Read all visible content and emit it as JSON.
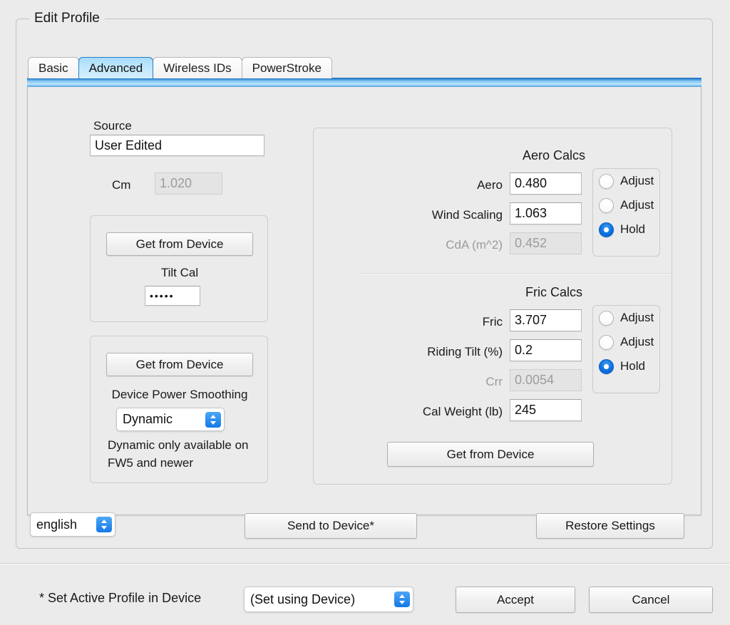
{
  "window": {
    "groupbox_title": "Edit Profile"
  },
  "tabs": [
    {
      "label": "Basic",
      "active": false
    },
    {
      "label": "Advanced",
      "active": true
    },
    {
      "label": "Wireless IDs",
      "active": false
    },
    {
      "label": "PowerStroke",
      "active": false
    }
  ],
  "left_panel": {
    "source_label": "Source",
    "source_value": "User Edited",
    "cm_label": "Cm",
    "cm_value": "1.020",
    "tilt_group": {
      "get_from_device_label": "Get from Device",
      "tilt_cal_label": "Tilt Cal",
      "tilt_cal_value": "•••••"
    },
    "smoothing_group": {
      "get_from_device_label": "Get from Device",
      "smoothing_label": "Device Power Smoothing",
      "smoothing_value": "Dynamic",
      "note_line1": "Dynamic only available on",
      "note_line2": "FW5 and newer"
    }
  },
  "right_panel": {
    "aero": {
      "title": "Aero Calcs",
      "rows": [
        {
          "label": "Aero",
          "value": "0.480",
          "disabled": false
        },
        {
          "label": "Wind Scaling",
          "value": "1.063",
          "disabled": false
        },
        {
          "label": "CdA (m^2)",
          "value": "0.452",
          "disabled": true
        }
      ],
      "options": [
        {
          "label": "Adjust",
          "selected": false
        },
        {
          "label": "Adjust",
          "selected": false
        },
        {
          "label": "Hold",
          "selected": true
        }
      ]
    },
    "fric": {
      "title": "Fric Calcs",
      "rows": [
        {
          "label": "Fric",
          "value": "3.707",
          "disabled": false
        },
        {
          "label": "Riding Tilt (%)",
          "value": "0.2",
          "disabled": false
        },
        {
          "label": "Crr",
          "value": "0.0054",
          "disabled": true
        },
        {
          "label": "Cal Weight (lb)",
          "value": "245",
          "disabled": false
        }
      ],
      "options": [
        {
          "label": "Adjust",
          "selected": false
        },
        {
          "label": "Adjust",
          "selected": false
        },
        {
          "label": "Hold",
          "selected": true
        }
      ]
    },
    "get_from_device_label": "Get from Device"
  },
  "footer": {
    "language_value": "english",
    "send_to_device_label": "Send to Device*",
    "restore_settings_label": "Restore Settings"
  },
  "bottom_bar": {
    "active_profile_label": "* Set Active Profile in Device",
    "active_profile_value": "(Set using Device)",
    "accept_label": "Accept",
    "cancel_label": "Cancel"
  },
  "colors": {
    "window_bg": "#ebebeb",
    "tab_active": "#bfe7fd",
    "tab_strip_blue": "#2c7cc8",
    "radio_selected": "#0a6fe0",
    "popup_arrow_bg": "#1479e8",
    "disabled_text": "#9a9a9a"
  }
}
